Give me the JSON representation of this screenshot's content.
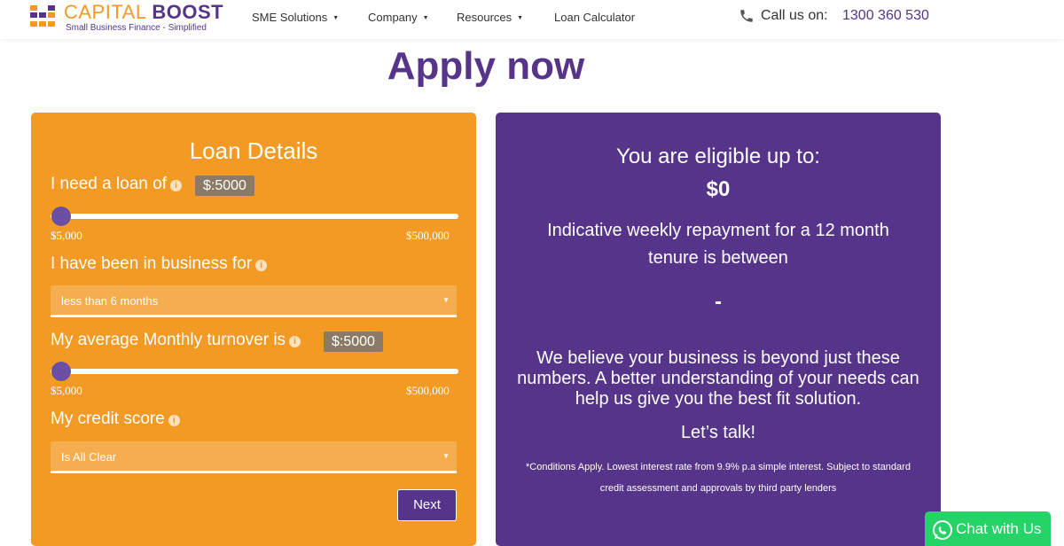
{
  "brand": {
    "name_part1": "CAPITAL ",
    "name_part2": "BOOST",
    "tagline": "Small Business Finance - Simplified",
    "colors": {
      "orange": "#f39a25",
      "purple": "#55348a",
      "chat_green": "#25d366"
    }
  },
  "nav": {
    "items": [
      {
        "label": "SME Solutions",
        "has_dropdown": true
      },
      {
        "label": "Company",
        "has_dropdown": true
      },
      {
        "label": "Resources",
        "has_dropdown": true
      },
      {
        "label": "Loan Calculator",
        "has_dropdown": false
      }
    ],
    "call_label": "Call us on:",
    "call_number": "1300 360 530",
    "phone_icon": "phone-icon"
  },
  "page": {
    "title": "Apply now"
  },
  "loan_form": {
    "title": "Loan Details",
    "loan_amount": {
      "label": "I need a loan of",
      "value": "$:5000",
      "min_label": "$5,000",
      "max_label": "$500,000",
      "min": 5000,
      "max": 500000,
      "current": 5000
    },
    "business_age": {
      "label": "I have been in business for",
      "selected": "less than 6 months"
    },
    "turnover": {
      "label": "My average Monthly turnover is",
      "value": "$:5000",
      "min_label": "$5,000",
      "max_label": "$500,000",
      "min": 5000,
      "max": 500000,
      "current": 5000
    },
    "credit_score": {
      "label": "My credit score",
      "selected": "Is All Clear"
    },
    "next_button": "Next"
  },
  "eligibility": {
    "heading": "You are eligible up to:",
    "amount": "$0",
    "indicative": "Indicative weekly repayment for a 12 month tenure is between",
    "range": "-",
    "believe": "We believe your business is beyond just these numbers. A better understanding of your needs can help us give you the best fit solution.",
    "talk": "Let’s talk!",
    "conditions": "*Conditions Apply. Lowest interest rate from 9.9% p.a simple interest. Subject to standard credit assessment and approvals by third party lenders"
  },
  "chat": {
    "label": "Chat with Us",
    "icon": "whatsapp-icon"
  }
}
